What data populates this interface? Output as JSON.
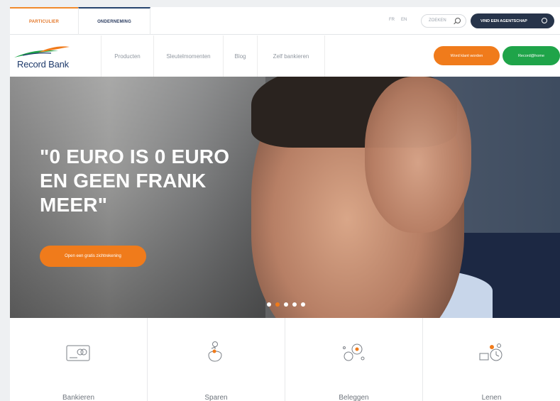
{
  "util": {
    "tabs": [
      "PARTICULIER",
      "ONDERNEMING"
    ],
    "langs": [
      "FR",
      "EN"
    ],
    "search_placeholder": "ZOEKEN",
    "agent_button": "VIND EEN AGENTSCHAP"
  },
  "nav": {
    "brand": "Record Bank",
    "items": [
      "Producten",
      "Sleutelmomenten",
      "Blog",
      "Zelf bankieren"
    ],
    "cta_primary": "Word klant worden",
    "cta_secondary": "Record@home"
  },
  "hero": {
    "title": "\"0 EURO IS 0 EURO EN GEEN FRANK MEER\"",
    "cta": "Open een gratis zichtrekening",
    "slides": 5,
    "active_slide": 2
  },
  "tiles": [
    {
      "label": "Bankieren",
      "icon": "bank-card-icon"
    },
    {
      "label": "Sparen",
      "icon": "piggy-bank-icon"
    },
    {
      "label": "Beleggen",
      "icon": "coins-growth-icon"
    },
    {
      "label": "Lenen",
      "icon": "money-clock-icon"
    }
  ],
  "colors": {
    "orange": "#f07b1b",
    "green": "#1fa449",
    "navy": "#27344a",
    "brand_blue": "#1f3b6b"
  }
}
